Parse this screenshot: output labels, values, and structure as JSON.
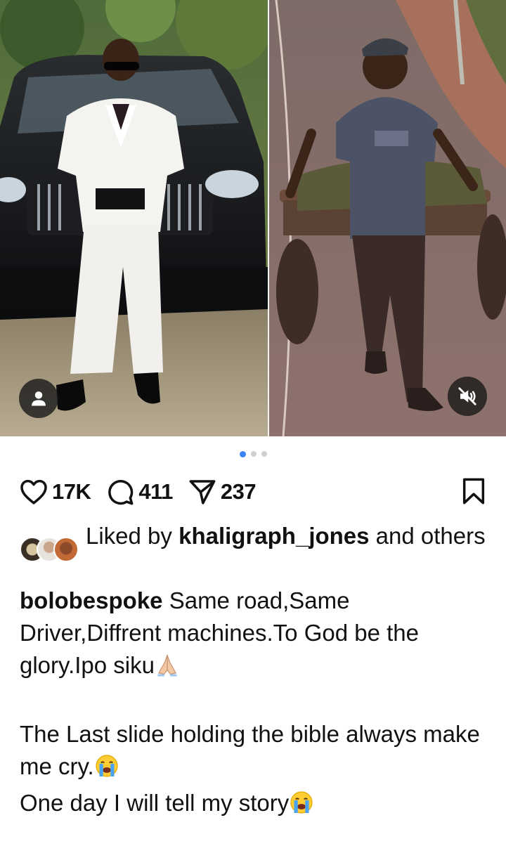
{
  "post": {
    "media": {
      "slide_count": 3,
      "active_slide": 1,
      "left_photo_alt": "Man in white tuxedo and sunglasses posing in front of a black SUV",
      "right_photo_alt": "Smiling man pulling a wooden hand cart loaded with branches on a road",
      "tag_icon": "person-icon",
      "mute_icon": "muted-speaker-icon"
    },
    "actions": {
      "likes": "17K",
      "comments": "411",
      "shares": "237",
      "like_icon": "heart-icon",
      "comment_icon": "comment-icon",
      "share_icon": "send-icon",
      "save_icon": "bookmark-icon"
    },
    "liked_by": {
      "prefix": "Liked by ",
      "username": "khaligraph_jones",
      "suffix": " and others"
    },
    "caption": {
      "username": "bolobespoke",
      "line1": " Same road,Same Driver,Diffrent machines.To God be the glory.Ipo siku",
      "emoji1": "praying-hands-emoji",
      "line2": "The Last slide holding the bible always make me cry.",
      "emoji2": "crying-face-emoji",
      "line3": "One day I will tell my story",
      "emoji3": "crying-face-emoji"
    },
    "colors": {
      "active_dot": "#3b82f6",
      "inactive_dot": "#cfcfcf",
      "text": "#111111"
    }
  }
}
